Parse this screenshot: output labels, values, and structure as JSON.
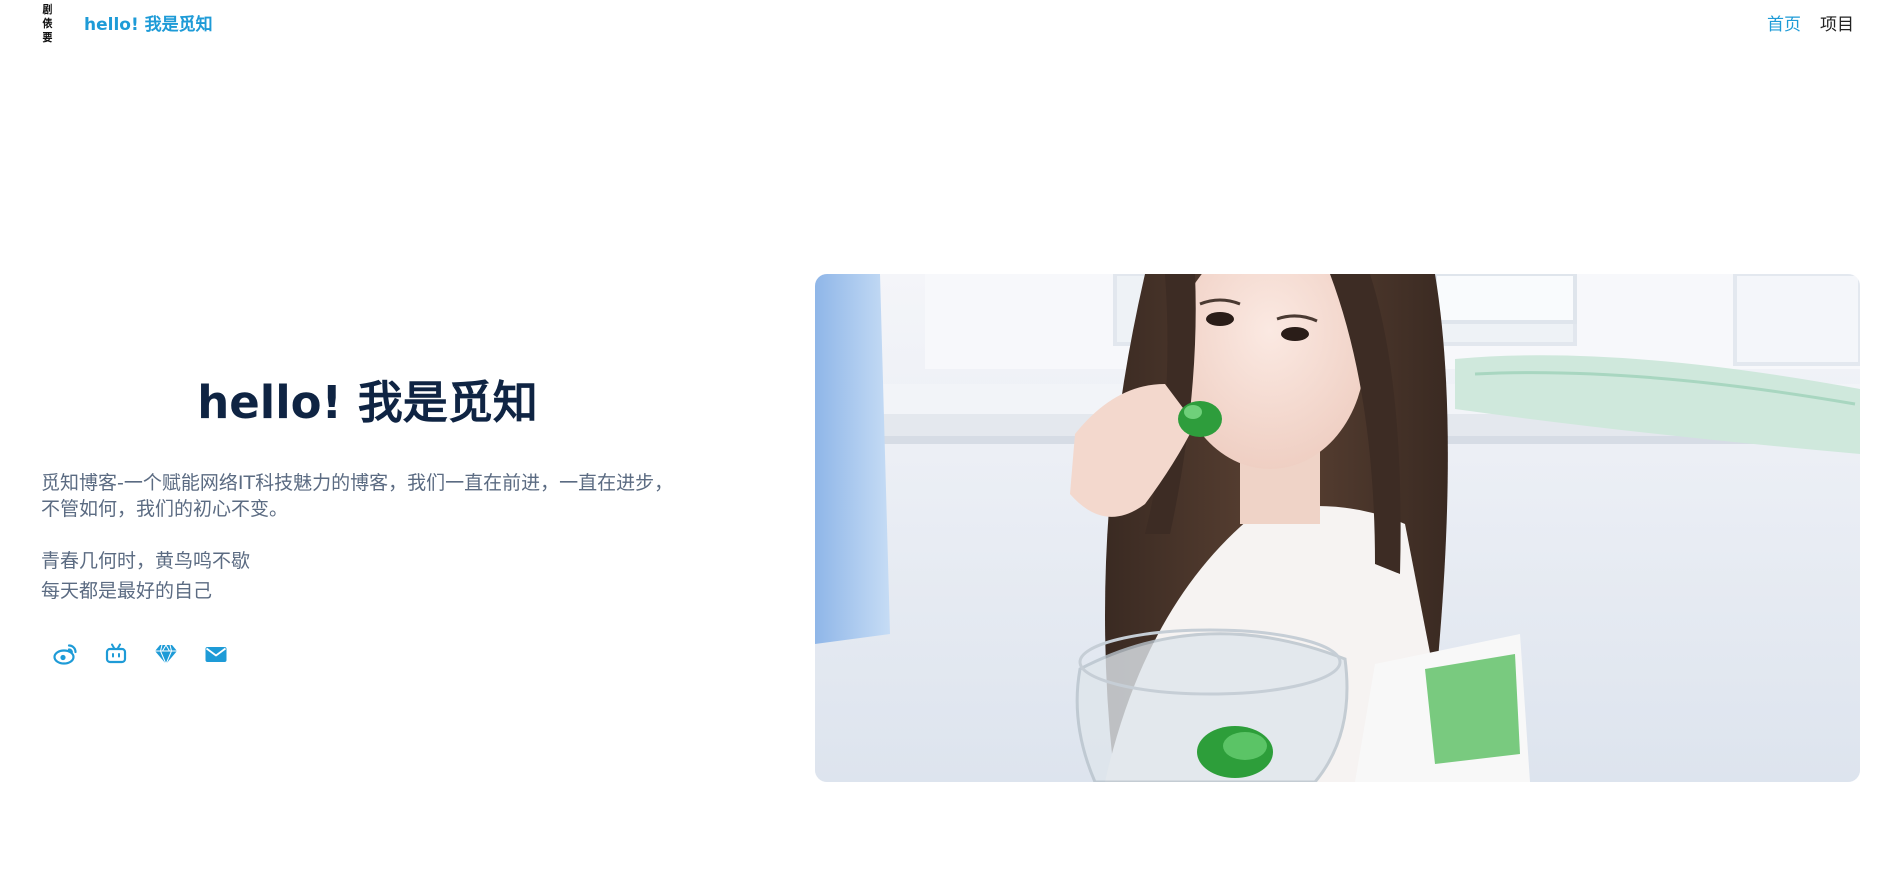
{
  "header": {
    "logo_chars": [
      "剧",
      "俵",
      "要"
    ],
    "brand": "hello! 我是觅知",
    "nav": [
      {
        "label": "首页",
        "active": true
      },
      {
        "label": "项目",
        "active": false
      }
    ]
  },
  "hero": {
    "title": "hello! 我是觅知",
    "description": "觅知博客-一个赋能网络IT科技魅力的博客，我们一直在前进，一直在进步，不管如何，我们的初心不变。",
    "quote_lines": [
      "青春几何时，黄鸟鸣不歇",
      "每天都是最好的自己"
    ]
  },
  "social_links": [
    {
      "icon": "weibo-icon"
    },
    {
      "icon": "bilibili-icon"
    },
    {
      "icon": "diamond-icon"
    },
    {
      "icon": "mail-icon"
    }
  ],
  "colors": {
    "accent": "#1e9bd7",
    "title": "#0f2443",
    "body_text": "#5b6b82"
  }
}
